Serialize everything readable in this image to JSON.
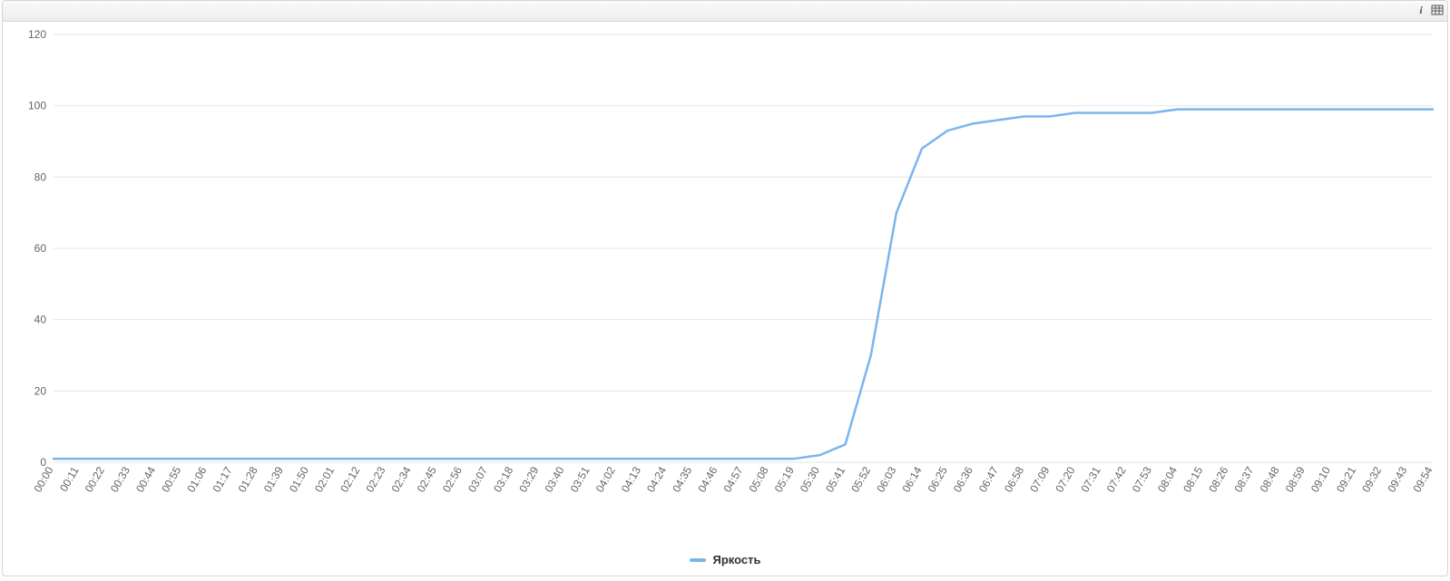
{
  "toolbar": {
    "info_icon": "i",
    "table_icon": "table"
  },
  "chart_data": {
    "type": "line",
    "series_name": "Яркость",
    "color": "#7cb5ec",
    "ylim": [
      0,
      120
    ],
    "y_ticks": [
      0,
      20,
      40,
      60,
      80,
      100,
      120
    ],
    "categories": [
      "00:00",
      "00:11",
      "00:22",
      "00:33",
      "00:44",
      "00:55",
      "01:06",
      "01:17",
      "01:28",
      "01:39",
      "01:50",
      "02:01",
      "02:12",
      "02:23",
      "02:34",
      "02:45",
      "02:56",
      "03:07",
      "03:18",
      "03:29",
      "03:40",
      "03:51",
      "04:02",
      "04:13",
      "04:24",
      "04:35",
      "04:46",
      "04:57",
      "05:08",
      "05:19",
      "05:30",
      "05:41",
      "05:52",
      "06:03",
      "06:14",
      "06:25",
      "06:36",
      "06:47",
      "06:58",
      "07:09",
      "07:20",
      "07:31",
      "07:42",
      "07:53",
      "08:04",
      "08:15",
      "08:26",
      "08:37",
      "08:48",
      "08:59",
      "09:10",
      "09:21",
      "09:32",
      "09:43",
      "09:54"
    ],
    "values": [
      1,
      1,
      1,
      1,
      1,
      1,
      1,
      1,
      1,
      1,
      1,
      1,
      1,
      1,
      1,
      1,
      1,
      1,
      1,
      1,
      1,
      1,
      1,
      1,
      1,
      1,
      1,
      1,
      1,
      1,
      2,
      5,
      30,
      70,
      88,
      93,
      95,
      96,
      97,
      97,
      98,
      98,
      98,
      98,
      99,
      99,
      99,
      99,
      99,
      99,
      99,
      99,
      99,
      99,
      99
    ]
  }
}
